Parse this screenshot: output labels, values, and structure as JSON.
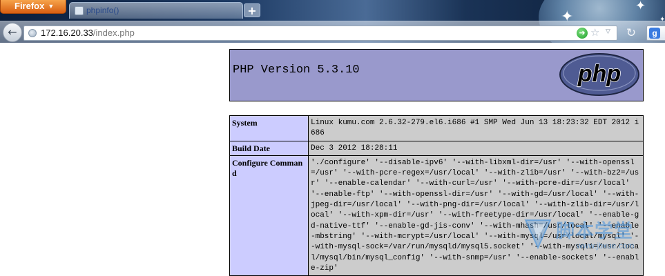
{
  "browser": {
    "menu_button_label": "Firefox",
    "tab_title": "phpinfo()",
    "new_tab_label": "+",
    "url_host": "172.16.20.33",
    "url_path": "/index.php",
    "search_engine_letter": "g"
  },
  "page": {
    "header_title": "PHP Version 5.3.10",
    "logo_text": "php",
    "rows": [
      {
        "key": "System",
        "value": "Linux kumu.com 2.6.32-279.el6.i686 #1 SMP Wed Jun 13 18:23:32 EDT 2012 i686"
      },
      {
        "key": "Build Date",
        "value": "Dec 3 2012 18:28:11"
      },
      {
        "key": "Configure Command",
        "value": "'./configure' '--disable-ipv6' '--with-libxml-dir=/usr' '--with-openssl=/usr' '--with-pcre-regex=/usr/local' '--with-zlib=/usr' '--with-bz2=/usr' '--enable-calendar' '--with-curl=/usr' '--with-pcre-dir=/usr/local' '--enable-ftp' '--with-openssl-dir=/usr' '--with-gd=/usr/local' '--with-jpeg-dir=/usr/local' '--with-png-dir=/usr/local' '--with-zlib-dir=/usr/local' '--with-xpm-dir=/usr' '--with-freetype-dir=/usr/local' '--enable-gd-native-ttf' '--enable-gd-jis-conv' '--with-mhash=/usr/local' '--enable-mbstring' '--with-mcrypt=/usr/local' '--with-mysql=/usr/local/mysql' '--with-mysql-sock=/var/run/mysqld/mysql5.socket' '--with-mysqli=/usr/local/mysql/bin/mysql_config' '--with-snmp=/usr' '--enable-sockets' '--enable-zip'"
      }
    ]
  },
  "watermark": {
    "text": "脚本学堂",
    "url": "www.jbxue.com"
  }
}
